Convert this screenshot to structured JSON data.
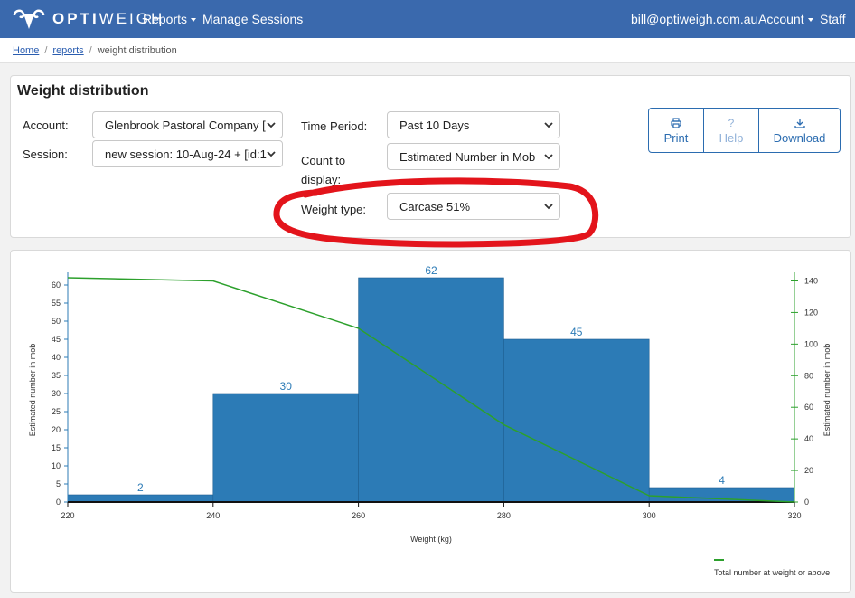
{
  "navbar": {
    "brand_left": "OPTI",
    "brand_right": "WEIGH",
    "reports": "Reports",
    "manage_sessions": "Manage Sessions",
    "user_email": "bill@optiweigh.com.au",
    "account": "Account",
    "staff": "Staff"
  },
  "breadcrumb": {
    "home": "Home",
    "reports": "reports",
    "current": "weight distribution"
  },
  "filters": {
    "title": "Weight distribution",
    "account_label": "Account:",
    "account_value": "Glenbrook Pastoral Company [",
    "session_label": "Session:",
    "session_value": "new session: 10-Aug-24 + [id:1",
    "time_label": "Time Period:",
    "time_value": "Past 10 Days",
    "count_label": "Count to display:",
    "count_value": "Estimated Number in Mob",
    "weight_type_label": "Weight type:",
    "weight_type_value": "Carcase 51%"
  },
  "buttons": {
    "print": "Print",
    "help": "Help",
    "download": "Download"
  },
  "annotation": {
    "color": "#e3141b",
    "shape": "hand-drawn ellipse around weight type"
  },
  "chart_data": {
    "type": "bar",
    "bins": [
      [
        220,
        240
      ],
      [
        240,
        260
      ],
      [
        260,
        280
      ],
      [
        280,
        300
      ],
      [
        300,
        320
      ]
    ],
    "values": [
      2,
      30,
      62,
      45,
      4
    ],
    "bar_color": "#2c7bb6",
    "line": {
      "name": "Total number at weight or above",
      "color": "#2ca02c",
      "x": [
        220,
        240,
        260,
        280,
        300,
        320
      ],
      "y": [
        142,
        140,
        110,
        49,
        4,
        0
      ]
    },
    "xlabel": "Weight (kg)",
    "ylabel_left": "Estimated number in mob",
    "ylabel_right": "Estimated number in mob",
    "x_ticks": [
      220,
      240,
      260,
      280,
      300,
      320
    ],
    "y_left_ticks": [
      0,
      5,
      10,
      15,
      20,
      25,
      30,
      35,
      40,
      45,
      50,
      55,
      60
    ],
    "y_right_ticks": [
      0,
      20,
      40,
      60,
      80,
      100,
      120,
      140
    ],
    "xlim": [
      220,
      320
    ],
    "ylim_left": [
      0,
      62
    ],
    "ylim_right": [
      0,
      142
    ],
    "legend_position": "bottom-right"
  }
}
